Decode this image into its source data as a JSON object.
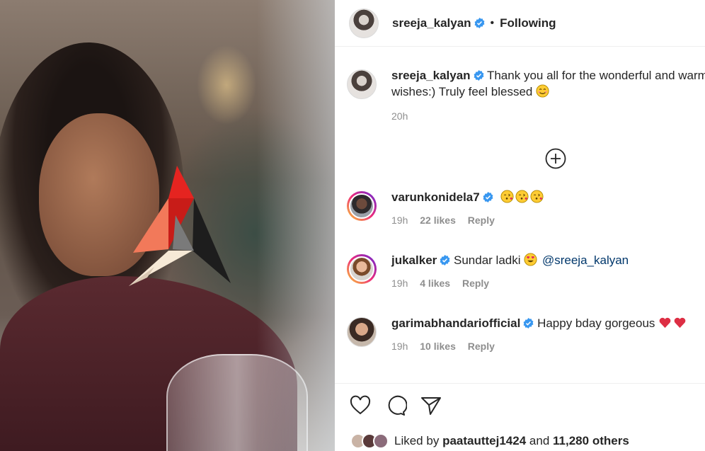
{
  "post_author": {
    "username": "sreeja_kalyan",
    "follow_status": "Following",
    "separator": "•"
  },
  "caption": {
    "username": "sreeja_kalyan",
    "text": "Thank you all for the wonderful and warm wishes:) Truly feel blessed",
    "emoji": "smiling-face-emoji",
    "time": "20h"
  },
  "load_more_icon": "plus-circle-icon",
  "comments": [
    {
      "username": "varunkonidela7",
      "text": "",
      "emojis": [
        "kissing-face-emoji",
        "kissing-face-emoji",
        "kissing-face-emoji"
      ],
      "time": "19h",
      "likes": "22 likes",
      "reply": "Reply"
    },
    {
      "username": "jukalker",
      "text": "Sundar ladki",
      "emojis": [
        "heart-eyes-emoji"
      ],
      "mention": "@sreeja_kalyan",
      "time": "19h",
      "likes": "4 likes",
      "reply": "Reply"
    },
    {
      "username": "garimabhandariofficial",
      "text": "Happy bday gorgeous",
      "emojis": [
        "red-heart-emoji",
        "red-heart-emoji"
      ],
      "time": "19h",
      "likes": "10 likes",
      "reply": "Reply"
    }
  ],
  "actions": {
    "like": "heart-icon",
    "comment": "comment-icon",
    "share": "send-icon"
  },
  "likes_summary": {
    "prefix": "Liked by",
    "user": "paatauttej1424",
    "conj": "and",
    "others": "11,280 others"
  },
  "colors": {
    "verified": "#3897f0",
    "mention": "#00376b",
    "meta": "#8e8e8e",
    "text": "#262626"
  }
}
